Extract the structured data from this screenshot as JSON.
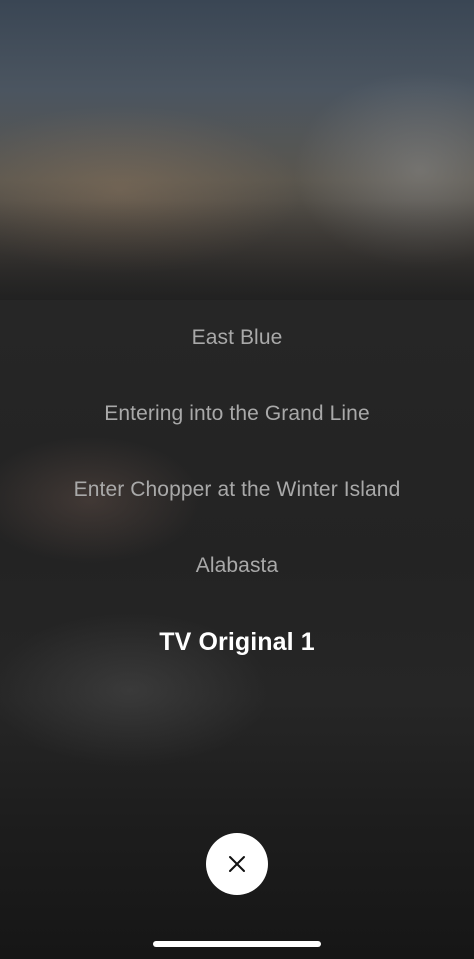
{
  "season_picker": {
    "items": [
      {
        "label": "East Blue",
        "selected": false
      },
      {
        "label": "Entering into the Grand Line",
        "selected": false
      },
      {
        "label": "Enter Chopper at the Winter Island",
        "selected": false
      },
      {
        "label": "Alabasta",
        "selected": false
      },
      {
        "label": "TV Original 1",
        "selected": true
      }
    ],
    "close_icon": "close-icon"
  },
  "colors": {
    "selected_text": "#ffffff",
    "unselected_text": "#a9a9a9",
    "close_button_bg": "#ffffff"
  }
}
